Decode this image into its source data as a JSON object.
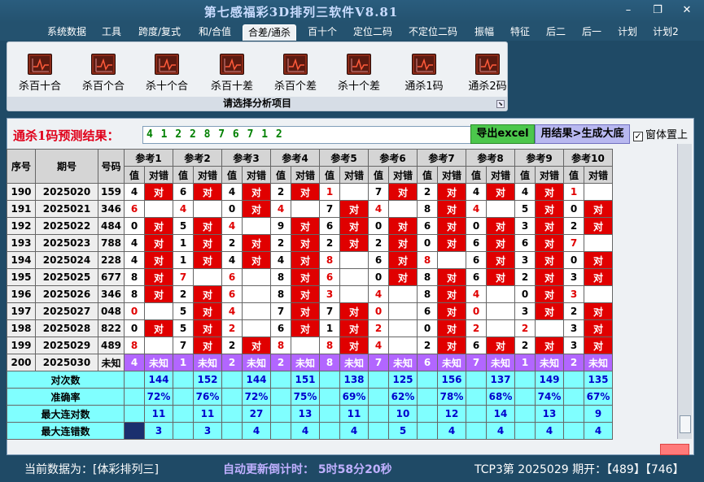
{
  "window": {
    "title": "第七感福彩3D排列三软件V8.81",
    "min": "–",
    "restore": "❐",
    "close": "✕"
  },
  "menu": [
    "系统数据",
    "工具",
    "跨度/复式",
    "和/合值",
    "合差/通杀",
    "百十个",
    "定位二码",
    "不定位二码",
    "振幅",
    "特征",
    "后二",
    "后一",
    "计划",
    "计划2"
  ],
  "menu_active_index": 4,
  "ribbon": {
    "tools": [
      "杀百十合",
      "杀百个合",
      "杀十个合",
      "杀百十差",
      "杀百个差",
      "杀十个差",
      "通杀1码",
      "通杀2码"
    ],
    "caption": "请选择分析项目",
    "tool_icon": "chart-line-icon",
    "launcher_icon": "dialog-launcher-icon"
  },
  "prediction": {
    "label": "通杀1码预测结果：",
    "value": "4  1  2  2  8  7  6  7  1  2"
  },
  "buttons": {
    "excel": "导出excel",
    "generate": "用结果>生成大底"
  },
  "checkbox": {
    "label": "窗体置上",
    "checked": true,
    "mark": "✓"
  },
  "table": {
    "headers": {
      "seq": "序号",
      "period": "期号",
      "number": "号码"
    },
    "refs": [
      "参考1",
      "参考2",
      "参考3",
      "参考4",
      "参考5",
      "参考6",
      "参考7",
      "参考8",
      "参考9",
      "参考10"
    ],
    "sub": [
      "值",
      "对错"
    ],
    "right_mark": "对",
    "unknown": "未知",
    "rows": [
      {
        "seq": "190",
        "period": "2025020",
        "num": "159",
        "v": [
          4,
          6,
          4,
          2,
          1,
          7,
          2,
          4,
          4,
          1
        ],
        "ok": [
          1,
          1,
          1,
          1,
          0,
          1,
          1,
          1,
          1,
          0
        ],
        "red": [
          0,
          0,
          0,
          0,
          1,
          0,
          0,
          0,
          0,
          1
        ]
      },
      {
        "seq": "191",
        "period": "2025021",
        "num": "346",
        "v": [
          6,
          4,
          0,
          4,
          7,
          4,
          8,
          4,
          5,
          0
        ],
        "ok": [
          0,
          0,
          1,
          0,
          1,
          0,
          1,
          0,
          1,
          1
        ],
        "red": [
          1,
          1,
          0,
          1,
          0,
          1,
          0,
          1,
          0,
          0
        ]
      },
      {
        "seq": "192",
        "period": "2025022",
        "num": "484",
        "v": [
          0,
          5,
          4,
          9,
          6,
          0,
          6,
          0,
          3,
          2
        ],
        "ok": [
          1,
          1,
          0,
          1,
          1,
          1,
          1,
          1,
          1,
          1
        ],
        "red": [
          0,
          0,
          1,
          0,
          0,
          0,
          0,
          0,
          0,
          0
        ]
      },
      {
        "seq": "193",
        "period": "2025023",
        "num": "788",
        "v": [
          4,
          1,
          2,
          2,
          2,
          2,
          0,
          6,
          6,
          7
        ],
        "ok": [
          1,
          1,
          1,
          1,
          1,
          1,
          1,
          1,
          1,
          0
        ],
        "red": [
          0,
          0,
          0,
          0,
          0,
          0,
          0,
          0,
          0,
          1
        ]
      },
      {
        "seq": "194",
        "period": "2025024",
        "num": "228",
        "v": [
          4,
          1,
          4,
          4,
          8,
          6,
          8,
          6,
          3,
          0
        ],
        "ok": [
          1,
          1,
          1,
          1,
          0,
          1,
          0,
          1,
          1,
          1
        ],
        "red": [
          0,
          0,
          0,
          0,
          1,
          0,
          1,
          0,
          0,
          0
        ]
      },
      {
        "seq": "195",
        "period": "2025025",
        "num": "677",
        "v": [
          8,
          7,
          6,
          8,
          6,
          0,
          8,
          6,
          2,
          3
        ],
        "ok": [
          1,
          0,
          0,
          1,
          0,
          1,
          1,
          1,
          1,
          1
        ],
        "red": [
          0,
          1,
          1,
          0,
          1,
          0,
          0,
          0,
          0,
          0
        ]
      },
      {
        "seq": "196",
        "period": "2025026",
        "num": "346",
        "v": [
          8,
          2,
          6,
          8,
          3,
          4,
          8,
          4,
          0,
          3
        ],
        "ok": [
          1,
          1,
          0,
          1,
          0,
          0,
          1,
          0,
          1,
          0
        ],
        "red": [
          0,
          0,
          1,
          0,
          1,
          1,
          0,
          1,
          0,
          1
        ]
      },
      {
        "seq": "197",
        "period": "2025027",
        "num": "048",
        "v": [
          0,
          5,
          4,
          7,
          7,
          0,
          6,
          0,
          3,
          2
        ],
        "ok": [
          0,
          1,
          0,
          1,
          1,
          0,
          1,
          0,
          1,
          1
        ],
        "red": [
          1,
          0,
          1,
          0,
          0,
          1,
          0,
          1,
          0,
          0
        ]
      },
      {
        "seq": "198",
        "period": "2025028",
        "num": "822",
        "v": [
          0,
          5,
          2,
          6,
          1,
          2,
          0,
          2,
          2,
          3
        ],
        "ok": [
          1,
          1,
          0,
          1,
          1,
          0,
          1,
          0,
          0,
          1
        ],
        "red": [
          0,
          0,
          1,
          0,
          0,
          1,
          0,
          1,
          1,
          0
        ]
      },
      {
        "seq": "199",
        "period": "2025029",
        "num": "489",
        "v": [
          8,
          7,
          2,
          8,
          8,
          4,
          2,
          6,
          2,
          3
        ],
        "ok": [
          0,
          1,
          1,
          0,
          1,
          0,
          1,
          1,
          1,
          1
        ],
        "red": [
          1,
          0,
          0,
          1,
          1,
          1,
          0,
          0,
          0,
          0
        ]
      }
    ],
    "pred_row": {
      "seq": "200",
      "period": "2025030",
      "num": "未知",
      "v": [
        4,
        1,
        2,
        2,
        8,
        7,
        6,
        7,
        1,
        2
      ]
    },
    "stats": [
      {
        "label": "对次数",
        "v": [
          144,
          152,
          144,
          151,
          138,
          125,
          156,
          137,
          149,
          135
        ]
      },
      {
        "label": "准确率",
        "v": [
          "72%",
          "76%",
          "72%",
          "75%",
          "69%",
          "62%",
          "78%",
          "68%",
          "74%",
          "67%"
        ]
      },
      {
        "label": "最大连对数",
        "v": [
          11,
          11,
          27,
          13,
          11,
          10,
          12,
          14,
          13,
          9
        ]
      },
      {
        "label": "最大连错数",
        "v": [
          3,
          3,
          4,
          4,
          4,
          5,
          4,
          4,
          4,
          4
        ]
      }
    ]
  },
  "status": {
    "left": "当前数据为：[体彩排列三]",
    "middle": "自动更新倒计时：  5时58分20秒",
    "right": "TCP3第 2025029 期开：【489】【746】"
  },
  "colors": {
    "right_cell": "#e00000",
    "predict_row": "#b266ff",
    "stats_cell": "#80ffff",
    "title_bar": "#24526f"
  }
}
